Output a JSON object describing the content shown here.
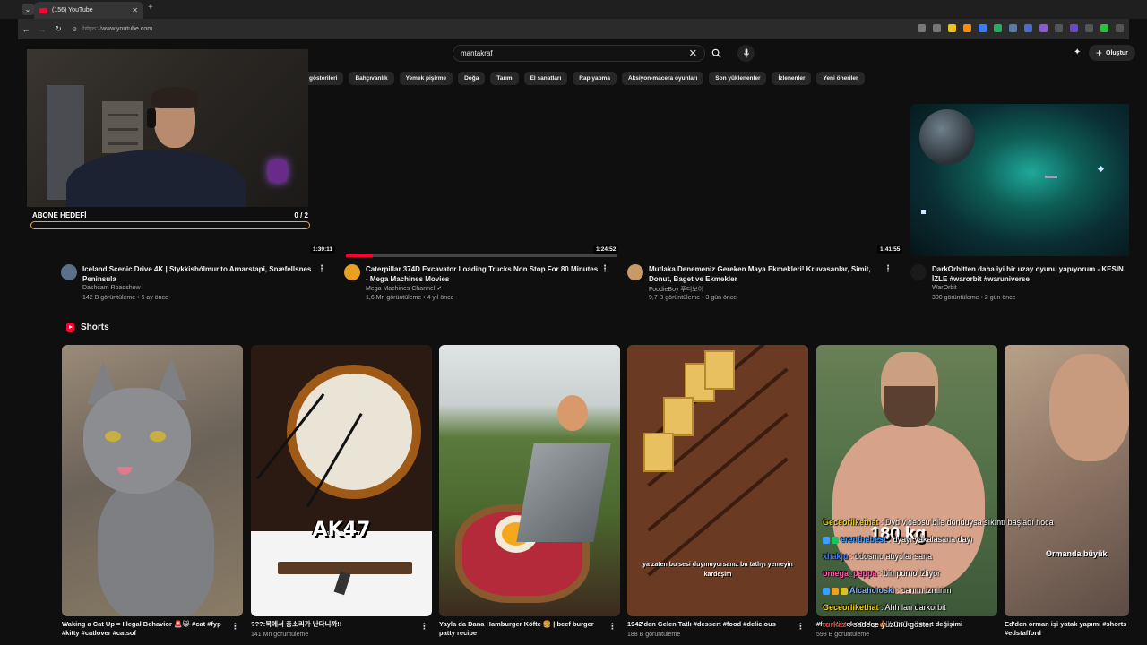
{
  "browser": {
    "tab_title": "(156) YouTube",
    "url_proto": "https://",
    "url_host": "www.youtube.com"
  },
  "header": {
    "search_query": "mantakraf",
    "create_label": "Oluştur"
  },
  "chips": [
    "gösterileri",
    "Bahçıvanlık",
    "Yemek pişirme",
    "Doğa",
    "Tarım",
    "El sanatları",
    "Rap yapma",
    "Aksiyon-macera oyunları",
    "Son yüklenenler",
    "İzlenenler",
    "Yeni öneriler"
  ],
  "stream_overlay": {
    "goal_label": "ABONE HEDEFİ",
    "goal_count": "0 / 2",
    "goal_progress": 0.0
  },
  "videos": [
    {
      "title": "Iceland Scenic Drive 4K | Stykkishólmur to Arnarstapi, Snæfellsnes Peninsula",
      "channel": "Dashcam Roadshow",
      "stats": "142 B görüntüleme • 6 ay önce",
      "duration": "1:39:11",
      "watched": 0.0,
      "avatar_color": "#5b6f8a"
    },
    {
      "title": "Caterpillar 374D Excavator Loading Trucks Non Stop For 80 Minutes - Mega Machines Movies",
      "channel": "Mega Machines Channel",
      "stats": "1,6 Mn görüntüleme • 4 yıl önce",
      "duration": "1:24:52",
      "watched": 0.1,
      "avatar_color": "#e8a020"
    },
    {
      "title": "Mutlaka Denemeniz Gereken Maya Ekmekleri! Kruvasanlar, Simit, Donut, Baget ve Ekmekler",
      "channel": "FoodieBoy 푸디보이",
      "stats": "9,7 B görüntüleme • 3 gün önce",
      "duration": "1:41:55",
      "watched": 0.0,
      "avatar_color": "#c89a6a"
    },
    {
      "title": "DarkOrbitten daha iyi bir uzay oyunu yapıyorum - KESIN İZLE #warorbit #waruniverse",
      "channel": "WarOrbit",
      "stats": "300 görüntüleme • 2 gün önce",
      "duration": "",
      "watched": 0.0,
      "avatar_color": "#1a1a1a"
    }
  ],
  "shorts": {
    "heading": "Shorts",
    "items": [
      {
        "title": "Waking a Cat Up = Illegal Behavior 🚨😹 #cat #fyp #kitty #catlover #catsof",
        "views": ""
      },
      {
        "title": "???:북에서 총소리가 난다니까!!",
        "views": "141 Mn görüntüleme",
        "overlay": "AK47"
      },
      {
        "title": "Yayla da Dana Hamburger Köfte 🍔 | beef burger patty recipe",
        "views": ""
      },
      {
        "title": "1942'den Gelen Tatlı #dessert #food #delicious",
        "views": "188 B görüntüleme",
        "overlay": "ya zaten bu sesi duymuyorsanız bu tatlıyı yemeyin kardeşim"
      },
      {
        "title": "#fun #tiktok 180 kg 🔥 / 156 kg vücut değişimi",
        "views": "598 B görüntüleme",
        "overlay": "180 kg"
      },
      {
        "title": "Ed'den orman işi yatak yapımı #shorts #edstafford",
        "views": "",
        "overlay": "Ormanda büyük"
      }
    ]
  },
  "chat": [
    {
      "user": "Geceorlikethat",
      "color": "#f0d020",
      "msg": "Dvd videosu bile donduysa sıkıntı başladı hoca"
    },
    {
      "user": "erenthebest",
      "color": "#40a0ff",
      "msg": "dyayı yakalasana dayı"
    },
    {
      "user": "xhakju",
      "color": "#3a7bff",
      "msg": "ddosmu atıyolar sana"
    },
    {
      "user": "omega_peppa",
      "color": "#ff5ab0",
      "msg": "biri porno izliyor"
    },
    {
      "user": "Alcaholoski",
      "color": "#7ab0ff",
      "msg": "canım izmirim"
    },
    {
      "user": "Geceorlikethat",
      "color": "#f0d020",
      "msg": "Ahh lan darkorbit"
    },
    {
      "user": "turkaz",
      "color": "#ff3030",
      "msg": "sadece yüzünü göster"
    }
  ]
}
